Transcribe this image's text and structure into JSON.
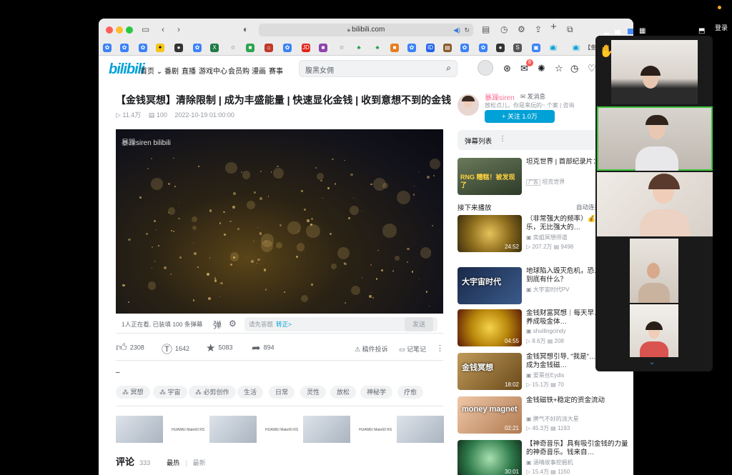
{
  "browser": {
    "url": "bilibili.com",
    "bookmark_label": "【金"
  },
  "zoom_top": {
    "login": "登录"
  },
  "site": {
    "logo": "bilibili",
    "nav": [
      {
        "label": "首页 ⌄"
      },
      {
        "label": "番剧"
      },
      {
        "label": "直播"
      },
      {
        "label": "游戏中心"
      },
      {
        "label": "会员购"
      },
      {
        "label": "漫画"
      },
      {
        "label": "赛事"
      }
    ],
    "search_placeholder": "腹黑女佣",
    "notification_count": "8"
  },
  "video": {
    "title": "【金钱冥想】清除限制 | 成为丰盛能量 | 快速显化金钱 | 收到意想不到的金钱",
    "views": "11.4万",
    "danmaku_count": "100",
    "date": "2022-10-19 01:00:00",
    "watermark": "暴躁siren bilibili",
    "watching": "1人正在看, 已装填 100 条弹幕",
    "dm_placeholder": "请先答题",
    "dm_link": "转正>",
    "dm_send": "发送",
    "likes": "2308",
    "coins": "1642",
    "favorites": "5083",
    "shares": "894",
    "report": "稿件投诉",
    "notes": "记笔记",
    "desc": "–",
    "tags": [
      "冥想",
      "宇宙",
      "必剪创作",
      "生活",
      "日常",
      "灵性",
      "放松",
      "神秘学",
      "疗愈"
    ],
    "ad_brand": "HUAWEI Mate60 RS",
    "comments_label": "评论",
    "comments_count": "333",
    "sort_hot": "最热",
    "sort_new": "最新"
  },
  "uploader": {
    "name": "暴躁siren",
    "message": "发消息",
    "bio": "放松点儿，你是来玩的~ 个案 | 咨询",
    "follow": "+ 关注 1.0万"
  },
  "sidebar": {
    "danmaku_list": "弹幕列表",
    "ad": {
      "title": "坦克世界 | 首部纪录片：战之王",
      "tag": "广告",
      "source": "坦克世界",
      "thumb_text": "RNG 糟糕！被发现了"
    },
    "next_label": "接下来播放",
    "autoplay": "自动连播",
    "items": [
      {
        "title": "（非常强大的频率）💰9… 治愈音乐，无比强大的…",
        "up": "奕姐冥想师道",
        "views": "207.2万",
        "dm": "9498",
        "dur": "24:52"
      },
      {
        "title": "地球陷入毁灭危机，恐… 知领域里到底有什么？",
        "up": "大宇宙时代PV",
        "views": "",
        "dm": "",
        "dur": "",
        "thumb_text": "大宇宙时代"
      },
      {
        "title": "金钱财富冥想｜每天早… 遍, 21天, 养成吸金体…",
        "up": "shuilingcindy",
        "views": "8.6万",
        "dm": "208",
        "dur": "04:55"
      },
      {
        "title": "金钱冥想引导, \"我是\"… 定句信念, 成为金钱磁…",
        "up": "爱蒂丝Eydis",
        "views": "15.1万",
        "dm": "70",
        "dur": "18:02",
        "thumb_text": "金钱冥想"
      },
      {
        "title": "金钱磁铁+稳定的资金流动",
        "up": "脾气不好的派大星",
        "views": "45.3万",
        "dm": "1193",
        "dur": "02:21",
        "thumb_text": "money magnet"
      },
      {
        "title": "【神奇音乐】具有吸引金钱的力量的神奇音乐。钱来自…",
        "up": "涵晴故事挖掘机",
        "views": "15.4万",
        "dm": "1150",
        "dur": "30:01"
      }
    ]
  },
  "colors": {
    "accent": "#00a1d6",
    "active_speaker": "#3ec33e"
  }
}
